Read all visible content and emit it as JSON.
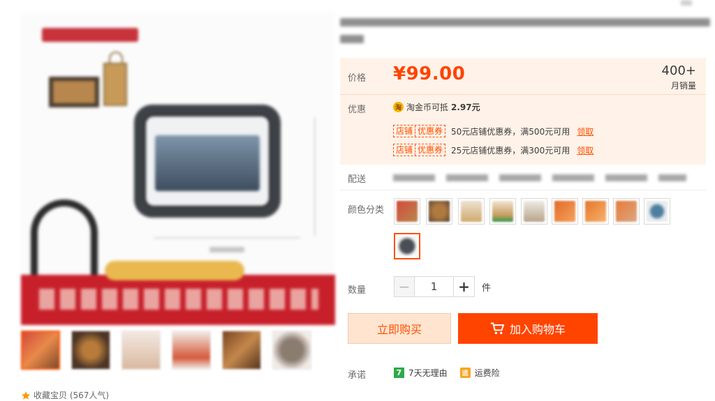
{
  "product": {
    "price": "¥99.00",
    "sales_count": "400+",
    "sales_label": "月销量"
  },
  "labels": {
    "price": "价格",
    "promo": "优惠",
    "shipping": "配送",
    "color": "颜色分类",
    "quantity": "数量",
    "promise": "承诺"
  },
  "promo": {
    "coin_icon": "淘",
    "coin_text": "淘金币可抵",
    "coin_amount": "2.97元",
    "coupons": [
      {
        "tag_left": "店铺",
        "tag_right": "优惠券",
        "desc": "50元店铺优惠券，满500元可用",
        "claim": "领取"
      },
      {
        "tag_left": "店铺",
        "tag_right": "优惠券",
        "desc": "25元店铺优惠券，满300元可用",
        "claim": "领取"
      }
    ]
  },
  "quantity": {
    "minus": "−",
    "value": "1",
    "plus": "+",
    "unit": "件"
  },
  "actions": {
    "buy_now": "立即购买",
    "add_cart": "加入购物车"
  },
  "promises": {
    "return_icon": "7",
    "return_text": "7天无理由",
    "shipping_icon": "运",
    "shipping_text": "运费险"
  },
  "favorite": {
    "text": "收藏宝贝 (567人气)"
  },
  "colors": {
    "accent": "#ff4400",
    "price_bg": "#fff2e8"
  }
}
